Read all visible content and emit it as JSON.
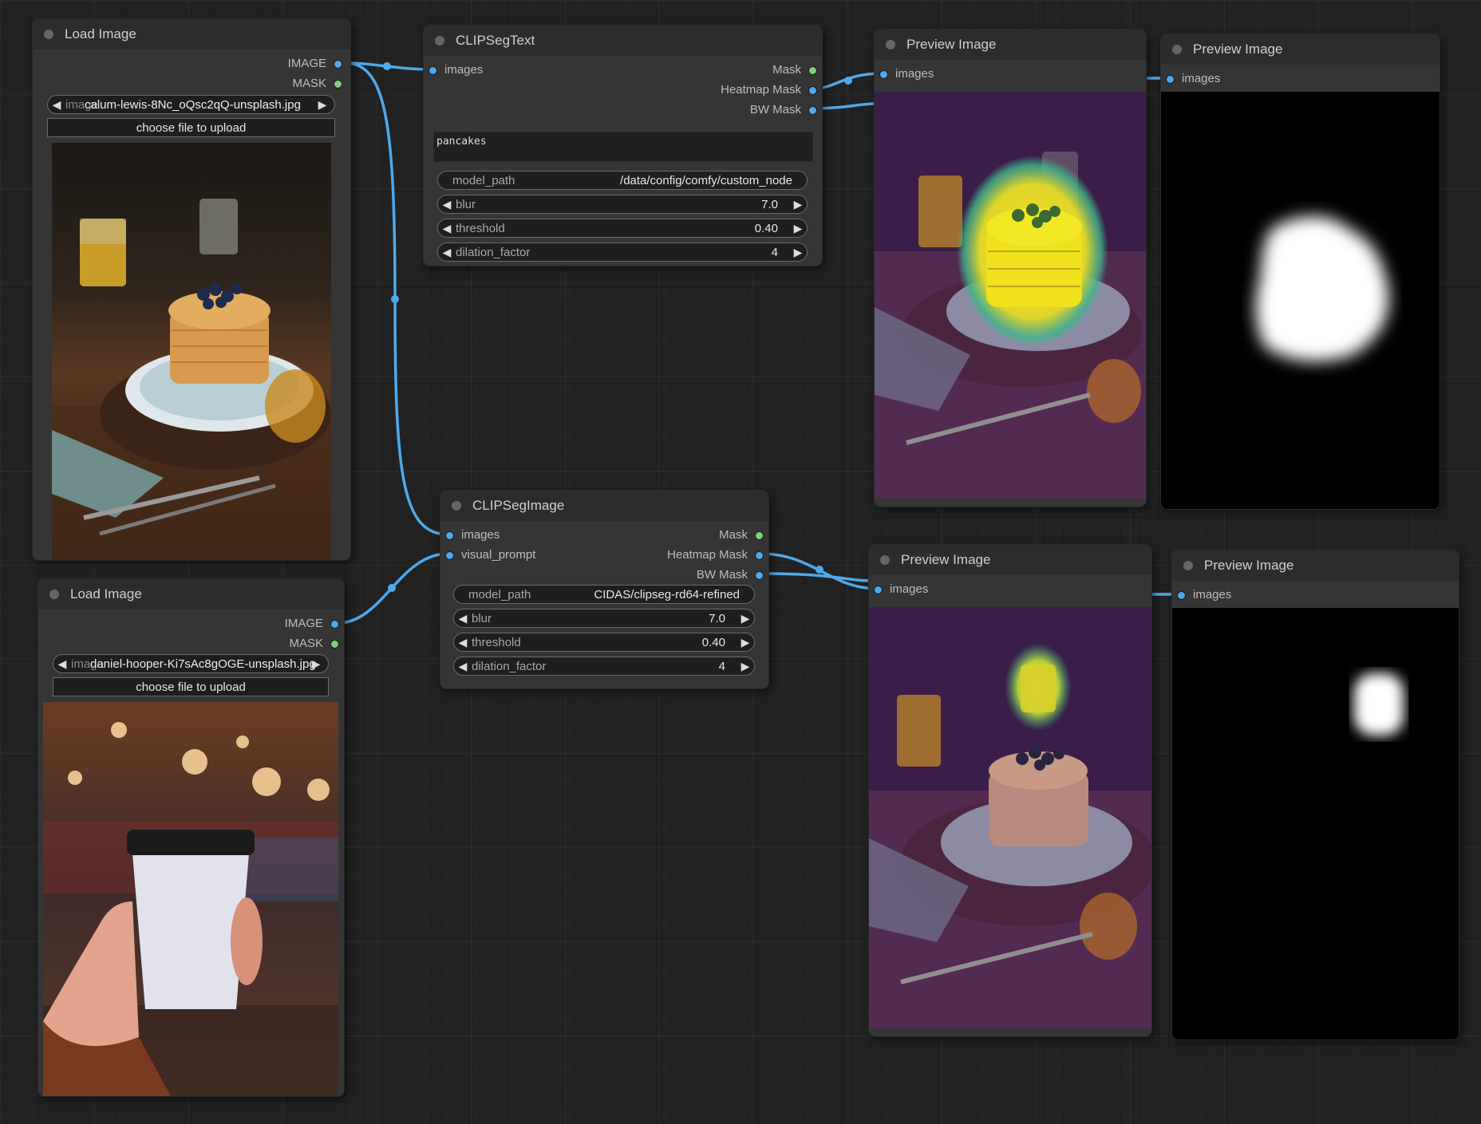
{
  "colors": {
    "link": "#4fa8ea",
    "image_slot": "#4fa8ea",
    "mask_slot": "#7fd07a",
    "node_bg": "#353535",
    "header_bg": "#2c2c2c"
  },
  "load_image_1": {
    "title": "Load Image",
    "outputs": {
      "image": "IMAGE",
      "mask": "MASK"
    },
    "file_label": "image",
    "file_value": "calum-lewis-8Nc_oQsc2qQ-unsplash.jpg",
    "upload_label": "choose file to upload",
    "preview_icon": "pancake-stack-photo"
  },
  "load_image_2": {
    "title": "Load Image",
    "outputs": {
      "image": "IMAGE",
      "mask": "MASK"
    },
    "file_label": "image",
    "file_value": "daniel-hooper-Ki7sAc8gOGE-unsplash.jpg",
    "upload_label": "choose file to upload",
    "preview_icon": "coffee-cup-photo"
  },
  "clipseg_text": {
    "title": "CLIPSegText",
    "inputs": {
      "images": "images"
    },
    "outputs": {
      "mask": "Mask",
      "heatmap": "Heatmap Mask",
      "bw": "BW Mask"
    },
    "prompt": "pancakes",
    "model_path": {
      "label": "model_path",
      "value": "/data/config/comfy/custom_node"
    },
    "blur": {
      "label": "blur",
      "value": "7.0"
    },
    "threshold": {
      "label": "threshold",
      "value": "0.40"
    },
    "dilation_factor": {
      "label": "dilation_factor",
      "value": "4"
    }
  },
  "clipseg_image": {
    "title": "CLIPSegImage",
    "inputs": {
      "images": "images",
      "visual_prompt": "visual_prompt"
    },
    "outputs": {
      "mask": "Mask",
      "heatmap": "Heatmap Mask",
      "bw": "BW Mask"
    },
    "model_path": {
      "label": "model_path",
      "value": "CIDAS/clipseg-rd64-refined"
    },
    "blur": {
      "label": "blur",
      "value": "7.0"
    },
    "threshold": {
      "label": "threshold",
      "value": "0.40"
    },
    "dilation_factor": {
      "label": "dilation_factor",
      "value": "4"
    }
  },
  "preview_1": {
    "title": "Preview Image",
    "input": "images",
    "content": "heatmap-pancakes"
  },
  "preview_2": {
    "title": "Preview Image",
    "input": "images",
    "content": "bw-mask-pancakes"
  },
  "preview_3": {
    "title": "Preview Image",
    "input": "images",
    "content": "heatmap-cup"
  },
  "preview_4": {
    "title": "Preview Image",
    "input": "images",
    "content": "bw-mask-cup"
  }
}
